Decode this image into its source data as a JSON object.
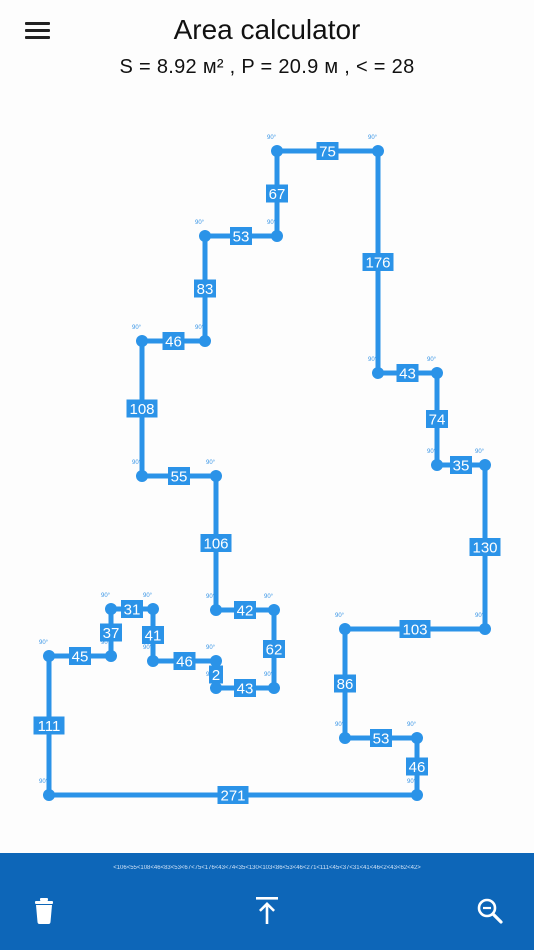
{
  "header": {
    "title": "Area calculator",
    "stats": "S = 8.92 м² , P = 20.9 м , < = 28",
    "menu_icon": "hamburger-menu-icon"
  },
  "plan": {
    "line_color": "#2b93e8",
    "label_bg": "#2b93e8",
    "label_text_color": "#ffffff",
    "vertex_angles": [
      "90°",
      "90°",
      "90°",
      "90°",
      "90°",
      "90°",
      "90°",
      "90°",
      "90°",
      "90°",
      "90°",
      "90°",
      "90°",
      "90°",
      "90°",
      "90°",
      "90°",
      "90°",
      "90°",
      "90°",
      "90°",
      "90°",
      "90°",
      "90°",
      "90°",
      "90°",
      "90°",
      "90°"
    ],
    "edge_labels": [
      "75",
      "176",
      "43",
      "74",
      "35",
      "130",
      "103",
      "86",
      "53",
      "46",
      "271",
      "111",
      "45",
      "37",
      "31",
      "41",
      "46",
      "2",
      "43",
      "62",
      "42",
      "106",
      "55",
      "108",
      "46",
      "83",
      "53",
      "67"
    ]
  },
  "bottom_bar": {
    "background": "#0d66b8",
    "angles_summary": "<106<55<108<46<83<53<67<75<176<43<74<35<130<103<86<53<46<271<111<45<37<31<41<46<2<43<62<42>",
    "buttons": [
      {
        "name": "delete-button",
        "icon": "trash-icon"
      },
      {
        "name": "export-button",
        "icon": "upload-icon"
      },
      {
        "name": "zoom-out-button",
        "icon": "zoom-out-icon"
      }
    ]
  }
}
